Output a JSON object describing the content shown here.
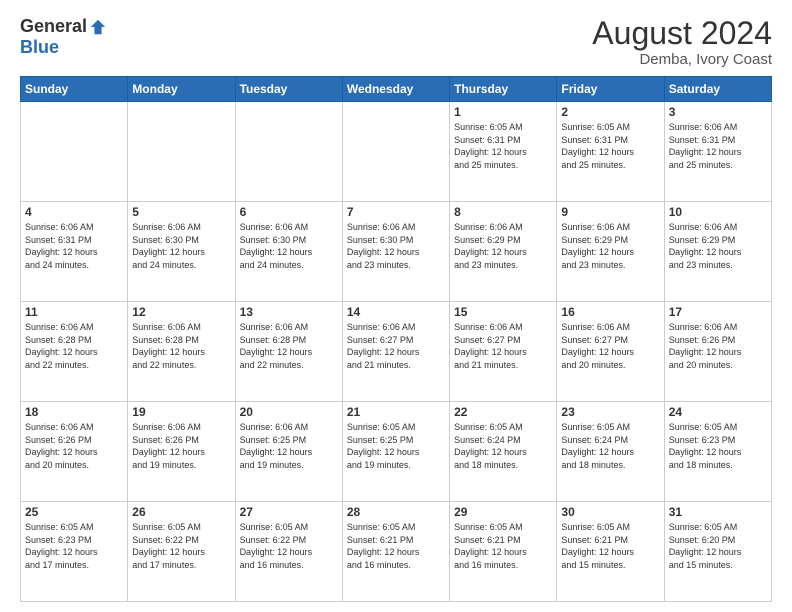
{
  "logo": {
    "general": "General",
    "blue": "Blue"
  },
  "header": {
    "title": "August 2024",
    "subtitle": "Demba, Ivory Coast"
  },
  "weekdays": [
    "Sunday",
    "Monday",
    "Tuesday",
    "Wednesday",
    "Thursday",
    "Friday",
    "Saturday"
  ],
  "weeks": [
    [
      {
        "day": "",
        "info": ""
      },
      {
        "day": "",
        "info": ""
      },
      {
        "day": "",
        "info": ""
      },
      {
        "day": "",
        "info": ""
      },
      {
        "day": "1",
        "info": "Sunrise: 6:05 AM\nSunset: 6:31 PM\nDaylight: 12 hours\nand 25 minutes."
      },
      {
        "day": "2",
        "info": "Sunrise: 6:05 AM\nSunset: 6:31 PM\nDaylight: 12 hours\nand 25 minutes."
      },
      {
        "day": "3",
        "info": "Sunrise: 6:06 AM\nSunset: 6:31 PM\nDaylight: 12 hours\nand 25 minutes."
      }
    ],
    [
      {
        "day": "4",
        "info": "Sunrise: 6:06 AM\nSunset: 6:31 PM\nDaylight: 12 hours\nand 24 minutes."
      },
      {
        "day": "5",
        "info": "Sunrise: 6:06 AM\nSunset: 6:30 PM\nDaylight: 12 hours\nand 24 minutes."
      },
      {
        "day": "6",
        "info": "Sunrise: 6:06 AM\nSunset: 6:30 PM\nDaylight: 12 hours\nand 24 minutes."
      },
      {
        "day": "7",
        "info": "Sunrise: 6:06 AM\nSunset: 6:30 PM\nDaylight: 12 hours\nand 23 minutes."
      },
      {
        "day": "8",
        "info": "Sunrise: 6:06 AM\nSunset: 6:29 PM\nDaylight: 12 hours\nand 23 minutes."
      },
      {
        "day": "9",
        "info": "Sunrise: 6:06 AM\nSunset: 6:29 PM\nDaylight: 12 hours\nand 23 minutes."
      },
      {
        "day": "10",
        "info": "Sunrise: 6:06 AM\nSunset: 6:29 PM\nDaylight: 12 hours\nand 23 minutes."
      }
    ],
    [
      {
        "day": "11",
        "info": "Sunrise: 6:06 AM\nSunset: 6:28 PM\nDaylight: 12 hours\nand 22 minutes."
      },
      {
        "day": "12",
        "info": "Sunrise: 6:06 AM\nSunset: 6:28 PM\nDaylight: 12 hours\nand 22 minutes."
      },
      {
        "day": "13",
        "info": "Sunrise: 6:06 AM\nSunset: 6:28 PM\nDaylight: 12 hours\nand 22 minutes."
      },
      {
        "day": "14",
        "info": "Sunrise: 6:06 AM\nSunset: 6:27 PM\nDaylight: 12 hours\nand 21 minutes."
      },
      {
        "day": "15",
        "info": "Sunrise: 6:06 AM\nSunset: 6:27 PM\nDaylight: 12 hours\nand 21 minutes."
      },
      {
        "day": "16",
        "info": "Sunrise: 6:06 AM\nSunset: 6:27 PM\nDaylight: 12 hours\nand 20 minutes."
      },
      {
        "day": "17",
        "info": "Sunrise: 6:06 AM\nSunset: 6:26 PM\nDaylight: 12 hours\nand 20 minutes."
      }
    ],
    [
      {
        "day": "18",
        "info": "Sunrise: 6:06 AM\nSunset: 6:26 PM\nDaylight: 12 hours\nand 20 minutes."
      },
      {
        "day": "19",
        "info": "Sunrise: 6:06 AM\nSunset: 6:26 PM\nDaylight: 12 hours\nand 19 minutes."
      },
      {
        "day": "20",
        "info": "Sunrise: 6:06 AM\nSunset: 6:25 PM\nDaylight: 12 hours\nand 19 minutes."
      },
      {
        "day": "21",
        "info": "Sunrise: 6:05 AM\nSunset: 6:25 PM\nDaylight: 12 hours\nand 19 minutes."
      },
      {
        "day": "22",
        "info": "Sunrise: 6:05 AM\nSunset: 6:24 PM\nDaylight: 12 hours\nand 18 minutes."
      },
      {
        "day": "23",
        "info": "Sunrise: 6:05 AM\nSunset: 6:24 PM\nDaylight: 12 hours\nand 18 minutes."
      },
      {
        "day": "24",
        "info": "Sunrise: 6:05 AM\nSunset: 6:23 PM\nDaylight: 12 hours\nand 18 minutes."
      }
    ],
    [
      {
        "day": "25",
        "info": "Sunrise: 6:05 AM\nSunset: 6:23 PM\nDaylight: 12 hours\nand 17 minutes."
      },
      {
        "day": "26",
        "info": "Sunrise: 6:05 AM\nSunset: 6:22 PM\nDaylight: 12 hours\nand 17 minutes."
      },
      {
        "day": "27",
        "info": "Sunrise: 6:05 AM\nSunset: 6:22 PM\nDaylight: 12 hours\nand 16 minutes."
      },
      {
        "day": "28",
        "info": "Sunrise: 6:05 AM\nSunset: 6:21 PM\nDaylight: 12 hours\nand 16 minutes."
      },
      {
        "day": "29",
        "info": "Sunrise: 6:05 AM\nSunset: 6:21 PM\nDaylight: 12 hours\nand 16 minutes."
      },
      {
        "day": "30",
        "info": "Sunrise: 6:05 AM\nSunset: 6:21 PM\nDaylight: 12 hours\nand 15 minutes."
      },
      {
        "day": "31",
        "info": "Sunrise: 6:05 AM\nSunset: 6:20 PM\nDaylight: 12 hours\nand 15 minutes."
      }
    ]
  ]
}
